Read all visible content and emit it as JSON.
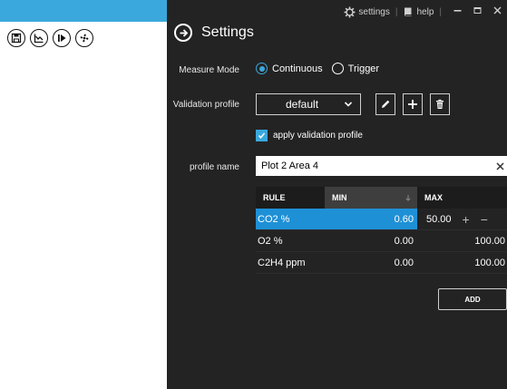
{
  "topbar": {
    "settings_label": "settings",
    "help_label": "help",
    "sep": "|"
  },
  "page": {
    "title": "Settings"
  },
  "measure_mode": {
    "label": "Measure Mode",
    "options": [
      "Continuous",
      "Trigger"
    ],
    "selected": "Continuous"
  },
  "validation_profile": {
    "label": "Validation profile",
    "selected": "default",
    "apply_label": "apply validation profile",
    "apply_checked": true
  },
  "profile_name": {
    "label": "profile name",
    "value": "Plot 2 Area 4"
  },
  "rules_table": {
    "headers": {
      "rule": "RULE",
      "min": "MIN",
      "max": "MAX"
    },
    "rows": [
      {
        "rule": "CO2 %",
        "min": "0.60",
        "max": "50.00",
        "selected": true
      },
      {
        "rule": "O2 %",
        "min": "0.00",
        "max": "100.00",
        "selected": false
      },
      {
        "rule": "C2H4 ppm",
        "min": "0.00",
        "max": "100.00",
        "selected": false
      }
    ]
  },
  "add_button": {
    "label": "ADD"
  },
  "colors": {
    "accent": "#3aa8dc",
    "selected_row": "#1e90d6",
    "panel_bg": "#232323"
  },
  "icons": {
    "left_toolbar": [
      "save-icon",
      "chart-icon",
      "play-step-icon",
      "fan-icon"
    ],
    "profile_actions": [
      "pencil-icon",
      "plus-icon",
      "trash-icon"
    ]
  }
}
